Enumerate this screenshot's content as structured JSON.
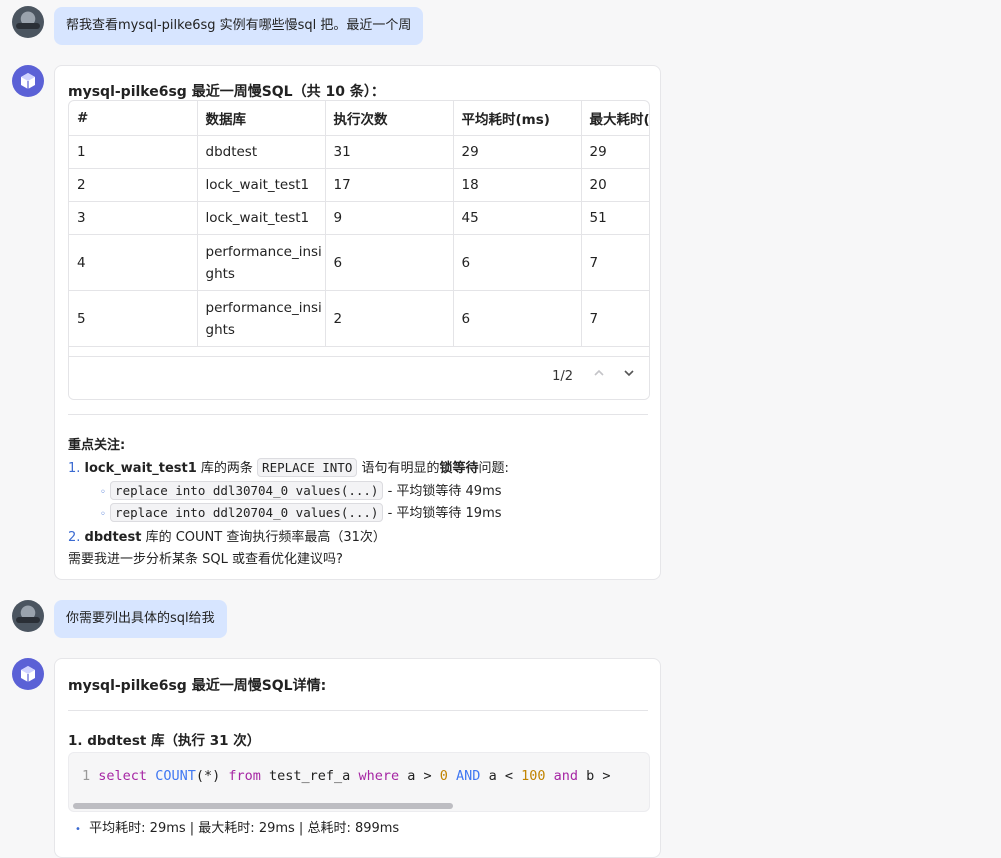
{
  "conversation": {
    "user_msg_1": "帮我查看mysql-pilke6sg 实例有哪些慢sql 把。最近一个周",
    "bot_msg_1": {
      "title": "mysql-pilke6sg 最近一周慢SQL（共 10 条）：",
      "table": {
        "headers": [
          "#",
          "数据库",
          "执行次数",
          "平均耗时(ms)",
          "最大耗时("
        ],
        "rows": [
          [
            "1",
            "dbdtest",
            "31",
            "29",
            "29"
          ],
          [
            "2",
            "lock_wait_test1",
            "17",
            "18",
            "20"
          ],
          [
            "3",
            "lock_wait_test1",
            "9",
            "45",
            "51"
          ],
          [
            "4",
            "performance_insi ghts",
            "6",
            "6",
            "7"
          ],
          [
            "5",
            "performance_insi ghts",
            "2",
            "6",
            "7"
          ]
        ],
        "page": "1/2"
      },
      "focus_heading": "重点关注:",
      "point1_index": "1.",
      "point1_db": "lock_wait_test1",
      "point1_text_a": " 库的两条 ",
      "point1_code": "REPLACE INTO",
      "point1_text_b": " 语句有明显的",
      "point1_bold": "锁等待",
      "point1_text_c": "问题:",
      "sub1_code": "replace into ddl30704_0 values(...)",
      "sub1_text": " - 平均锁等待 49ms",
      "sub2_code": "replace into ddl20704_0 values(...)",
      "sub2_text": " - 平均锁等待 19ms",
      "point2_index": "2.",
      "point2_db": "dbdtest",
      "point2_text": " 库的 COUNT 查询执行频率最高（31次）",
      "followup": "需要我进一步分析某条 SQL 或查看优化建议吗?"
    },
    "user_msg_2": "你需要列出具体的sql给我",
    "bot_msg_2": {
      "title": "mysql-pilke6sg 最近一周慢SQL详情:",
      "section_title": "1. dbdtest 库（执行 31 次）",
      "code": {
        "line_no": "1",
        "kw1": "select",
        "fn": "COUNT",
        "paren": "(*)",
        "kw2": "from",
        "t1": "test_ref_a",
        "kw3": "where",
        "c1": "a >",
        "n1": "0",
        "and1": "AND",
        "c2": "a <",
        "n2": "100",
        "and2": "and",
        "c3": "b >"
      },
      "stats": "平均耗时: 29ms | 最大耗时: 29ms | 总耗时: 899ms"
    }
  },
  "icons": {
    "bot": "cube-icon",
    "pager_up": "chevron-up-icon",
    "pager_down": "chevron-down-icon"
  }
}
